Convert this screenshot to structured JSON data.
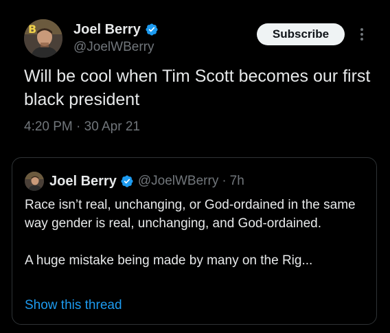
{
  "tweet": {
    "author_name": "Joel Berry",
    "handle": "@JoelWBerry",
    "subscribe_label": "Subscribe",
    "text": "Will be cool when Tim Scott becomes our first black president",
    "timestamp": "4:20 PM · 30 Apr 21"
  },
  "quoted_tweet": {
    "author_name": "Joel Berry",
    "handle": "@JoelWBerry",
    "separator": "·",
    "time": "7h",
    "paragraphs": [
      "Race isn’t real, unchanging, or God-ordained in the same way gender is real, unchanging, and God-ordained.",
      "A huge mistake being made by many on the Rig..."
    ],
    "show_thread_label": "Show this thread"
  },
  "colors": {
    "background": "#000000",
    "text_primary": "#e7e9ea",
    "text_secondary": "#71767b",
    "accent_link": "#1d9bf0",
    "verified_badge": "#1d9bf0",
    "button_bg": "#eff3f4",
    "border": "#2f3336"
  },
  "icons": {
    "verified": "verified-badge-icon",
    "more": "more-vertical-icon"
  }
}
